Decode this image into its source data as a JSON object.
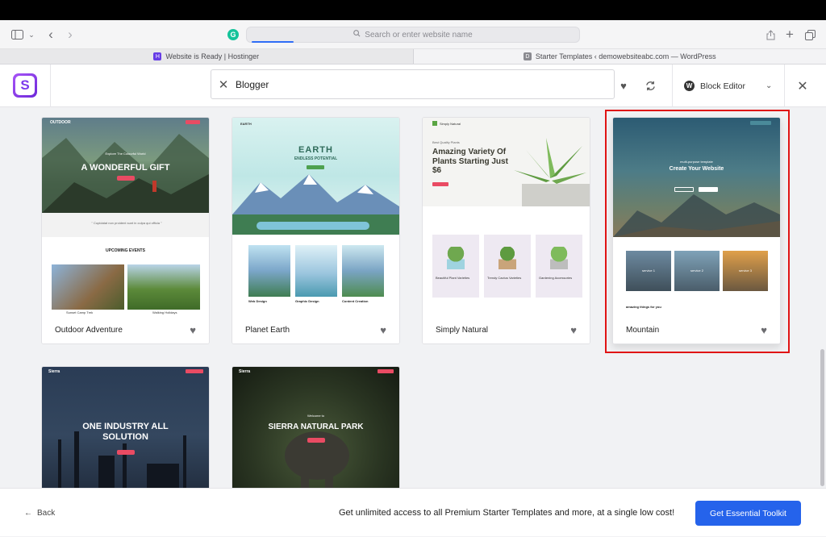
{
  "browser": {
    "address_placeholder": "Search or enter website name",
    "grammarly_letter": "G"
  },
  "tabs": [
    {
      "label": "Website is Ready | Hostinger",
      "favicon": "H"
    },
    {
      "label": "Starter Templates ‹ demowebsiteabc.com — WordPress",
      "favicon": "D"
    }
  ],
  "header": {
    "logo_letter": "S",
    "search_value": "Blogger",
    "editor_label": "Block Editor",
    "wp_letter": "W"
  },
  "templates": [
    {
      "name": "Outdoor Adventure",
      "hero_title": "A WONDERFUL GIFT",
      "hero_sub": "Explore The Colourful World",
      "brand": "OUTDOOR",
      "section": "UPCOMING EVENTS",
      "captions": [
        "Sunset Camp Trek",
        "Walking Holidays"
      ]
    },
    {
      "name": "Planet Earth",
      "hero_title": "EARTH",
      "hero_sub": "ENDLESS POTENTIAL",
      "brand": "EARTH",
      "captions": [
        "Web Design",
        "Graphic Design",
        "Content Creation"
      ]
    },
    {
      "name": "Simply Natural",
      "hero_title": "Amazing Variety Of Plants Starting Just $6",
      "hero_sub": "Best Quality Plants",
      "brand": "Simply Natural",
      "captions": [
        "Beautiful Plant Varieties",
        "Trendy Cactus Varieties",
        "Gardening Accessories"
      ]
    },
    {
      "name": "Mountain",
      "hero_title": "Create Your Website",
      "hero_sub": "multi-purpose template",
      "services": [
        "service 1",
        "service 2",
        "service 3"
      ],
      "tagline": "amazing things for you"
    },
    {
      "name": "",
      "hero_title": "ONE INDUSTRY ALL SOLUTION",
      "brand": "Sierra"
    },
    {
      "name": "",
      "hero_title": "SIERRA NATURAL PARK",
      "hero_sub": "Welcome to",
      "brand": "Sierra"
    }
  ],
  "footer": {
    "back_label": "Back",
    "promo_text": "Get unlimited access to all Premium Starter Templates and more, at a single low cost!",
    "cta_label": "Get Essential Toolkit"
  }
}
